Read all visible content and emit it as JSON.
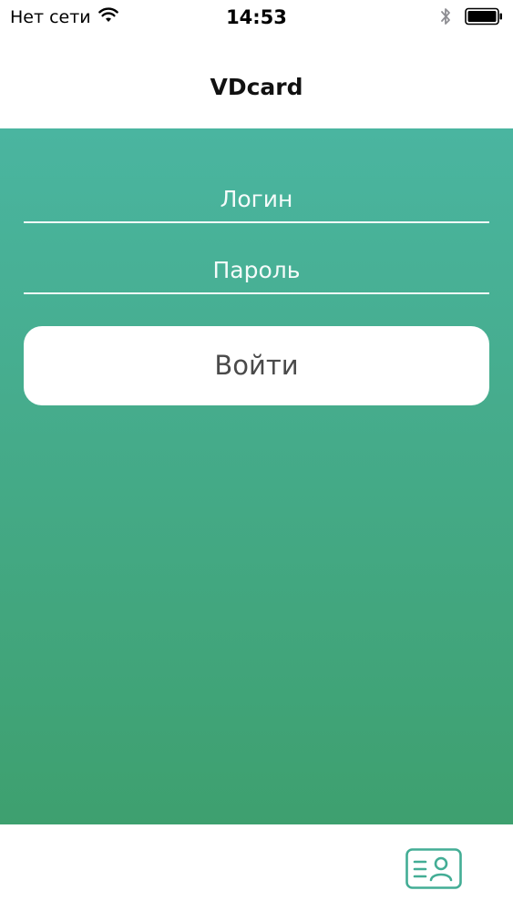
{
  "status_bar": {
    "carrier": "Нет сети",
    "time": "14:53",
    "icons": [
      "wifi-icon",
      "bluetooth-icon",
      "battery-icon"
    ]
  },
  "nav": {
    "title": "VDcard"
  },
  "form": {
    "login_placeholder": "Логин",
    "login_value": "",
    "password_placeholder": "Пароль",
    "password_value": "",
    "submit_label": "Войти"
  },
  "tab_bar": {
    "items": [
      {
        "icon": "contact-card-icon",
        "active": true
      }
    ]
  },
  "colors": {
    "gradient_top": "#4ab5a0",
    "gradient_bottom": "#3ea06f",
    "tab_accent": "#43ad95",
    "button_text": "#4a4a4a"
  }
}
